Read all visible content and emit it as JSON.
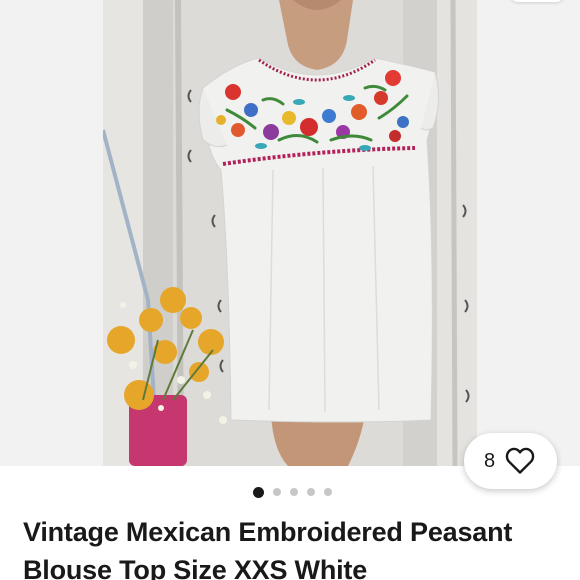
{
  "listing": {
    "title": "Vintage Mexican Embroidered Peasant Blouse Top Size XXS White",
    "like_count": "8",
    "image_count": 5,
    "active_image_index": 0
  },
  "icons": {
    "favorite": "heart-outline-icon"
  },
  "colors": {
    "text": "#191919",
    "gallery_background": "#f2f2f2",
    "dot_inactive": "#c7c7c7",
    "dot_active": "#191919"
  }
}
